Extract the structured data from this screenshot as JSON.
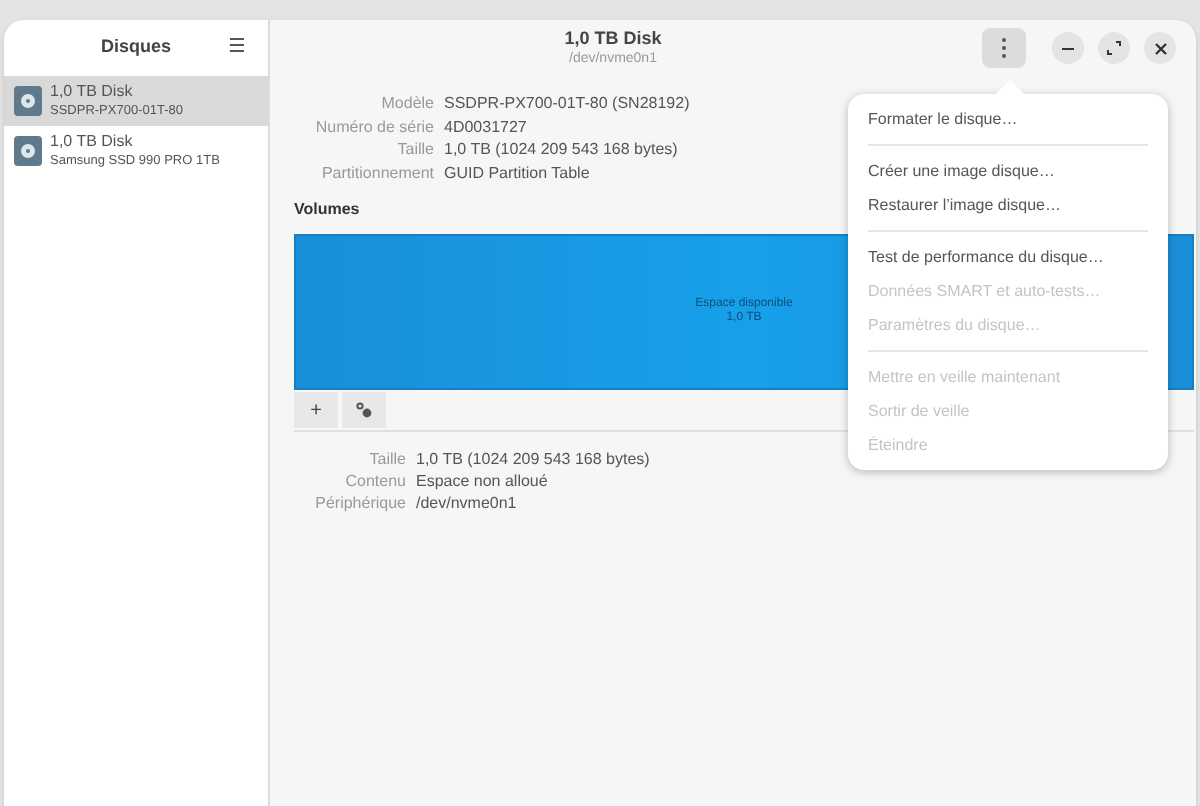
{
  "sidebar": {
    "title": "Disques",
    "disks": [
      {
        "name": "1,0 TB Disk",
        "model": "SSDPR-PX700-01T-80",
        "selected": true
      },
      {
        "name": "1,0 TB Disk",
        "model": "Samsung SSD 990 PRO 1TB",
        "selected": false
      }
    ]
  },
  "header": {
    "title": "1,0 TB Disk",
    "subtitle": "/dev/nvme0n1"
  },
  "disk_info": [
    {
      "label": "Modèle",
      "value": "SSDPR-PX700-01T-80 (SN28192)"
    },
    {
      "label": "Numéro de série",
      "value": "4D0031727"
    },
    {
      "label": "Taille",
      "value": "1,0 TB (1024 209 543 168 bytes)"
    },
    {
      "label": "Partitionnement",
      "value": "GUID Partition Table"
    }
  ],
  "volumes": {
    "title": "Volumes",
    "segment": {
      "line_1": "Espace disponible",
      "line_2": "1,0 TB"
    },
    "buttons": [
      "+"
    ],
    "info": [
      {
        "label": "Taille",
        "value": "1,0 TB (1024 209 543 168 bytes)"
      },
      {
        "label": "Contenu",
        "value": "Espace non alloué"
      },
      {
        "label": "Périphérique",
        "value": "/dev/nvme0n1"
      }
    ]
  },
  "menu": [
    [
      {
        "label": "Formater le disque…",
        "disabled": false
      }
    ],
    [
      {
        "label": "Créer une image disque…",
        "disabled": false
      },
      {
        "label": "Restaurer l’image disque…",
        "disabled": false
      }
    ],
    [
      {
        "label": "Test de performance du disque…",
        "disabled": false
      },
      {
        "label": "Données SMART et auto-tests…",
        "disabled": true
      },
      {
        "label": "Paramètres du disque…",
        "disabled": true
      }
    ],
    [
      {
        "label": "Mettre en veille maintenant",
        "disabled": true
      },
      {
        "label": "Sortir de veille",
        "disabled": true
      },
      {
        "label": "Éteindre",
        "disabled": true
      }
    ]
  ]
}
